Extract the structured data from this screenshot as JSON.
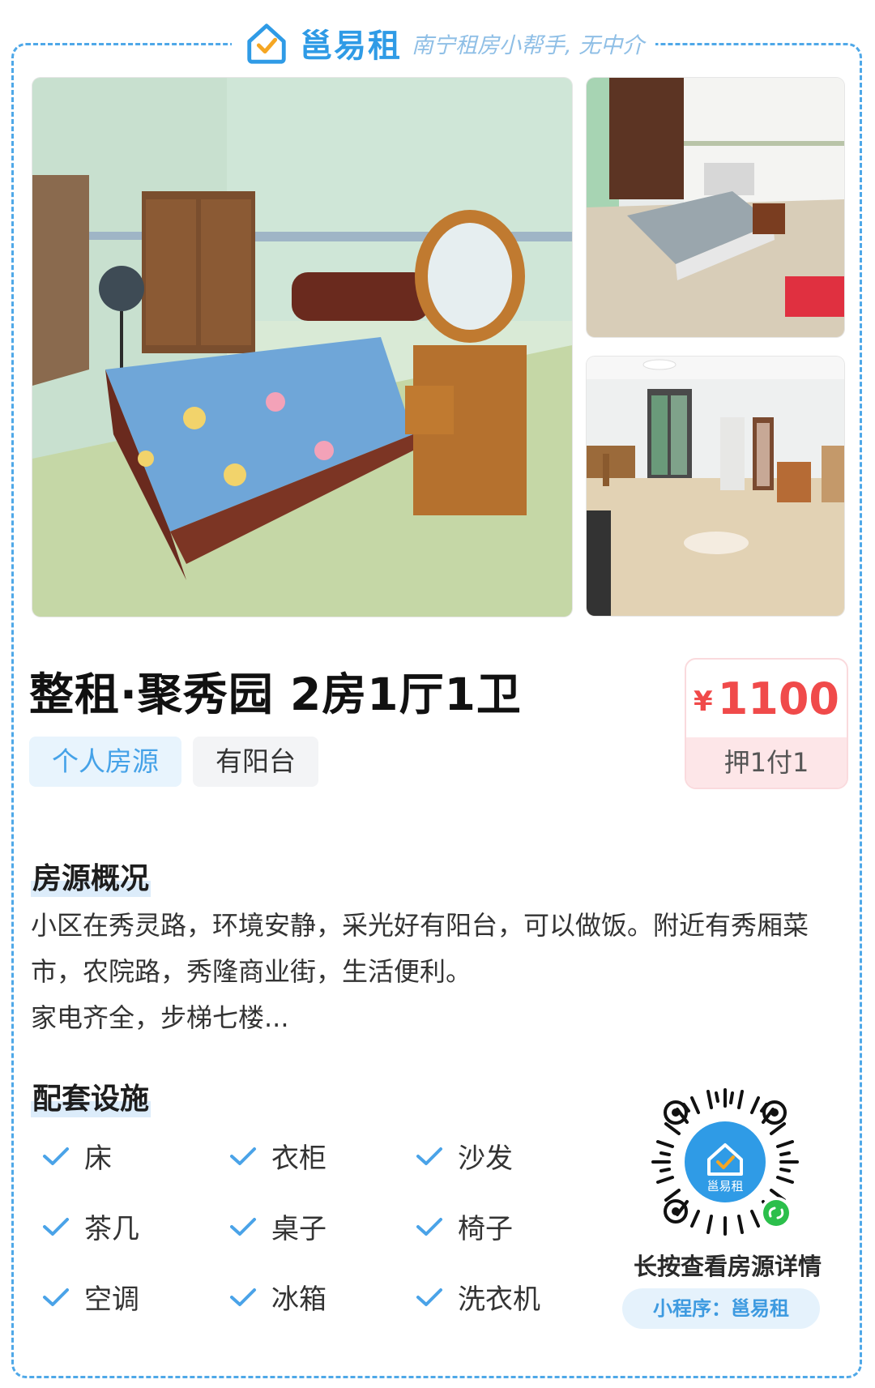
{
  "brand": {
    "name": "邕易租",
    "slogan": "南宁租房小帮手, 无中介",
    "accent_color": "#2f9be6"
  },
  "listing": {
    "title": "整租·聚秀园 2房1厅1卫",
    "tags": [
      "个人房源",
      "有阳台"
    ],
    "price": {
      "currency_symbol": "¥",
      "amount": "1100",
      "payment_terms": "押1付1",
      "color": "#f04a4a"
    },
    "photos": [
      "bedroom-photo",
      "bedroom-second-photo",
      "living-room-photo"
    ]
  },
  "overview": {
    "heading": "房源概况",
    "lines": [
      "小区在秀灵路，环境安静，采光好有阳台，可以做饭。附近有秀厢菜市，农院路，秀隆商业街，生活便利。",
      "家电齐全，步梯七楼..."
    ]
  },
  "facilities": {
    "heading": "配套设施",
    "items": [
      "床",
      "衣柜",
      "沙发",
      "茶几",
      "桌子",
      "椅子",
      "空调",
      "冰箱",
      "洗衣机"
    ]
  },
  "qr": {
    "center_label": "邕易租",
    "caption": "长按查看房源详情",
    "miniprogram": "小程序：邕易租"
  }
}
